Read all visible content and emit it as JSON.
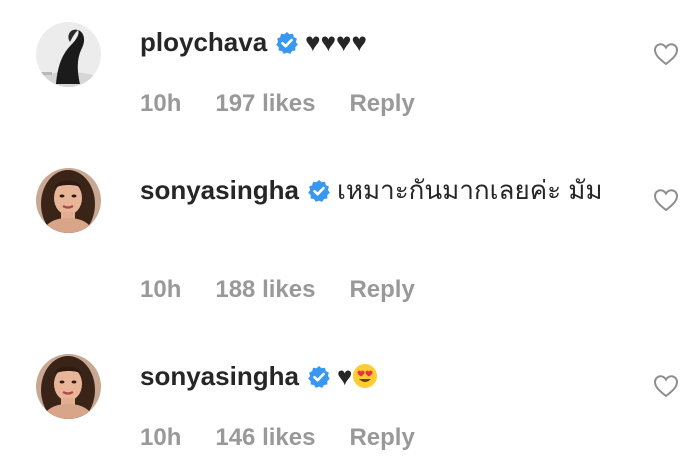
{
  "comments": [
    {
      "username": "ploychava",
      "text": "♥♥♥♥",
      "time": "10h",
      "likes": "197 likes",
      "reply": "Reply"
    },
    {
      "username": "sonyasingha",
      "text": "เหมาะกันมากเลยค่ะ มัม",
      "time": "10h",
      "likes": "188 likes",
      "reply": "Reply"
    },
    {
      "username": "sonyasingha",
      "text": "♥",
      "time": "10h",
      "likes": "146 likes",
      "reply": "Reply"
    }
  ],
  "icons": {
    "verified": "verified-badge-icon",
    "like": "heart-outline-icon",
    "emoji": "heart-eyes-emoji-icon"
  },
  "colors": {
    "verified": "#3897f0",
    "meta": "#999999",
    "text": "#262626"
  }
}
